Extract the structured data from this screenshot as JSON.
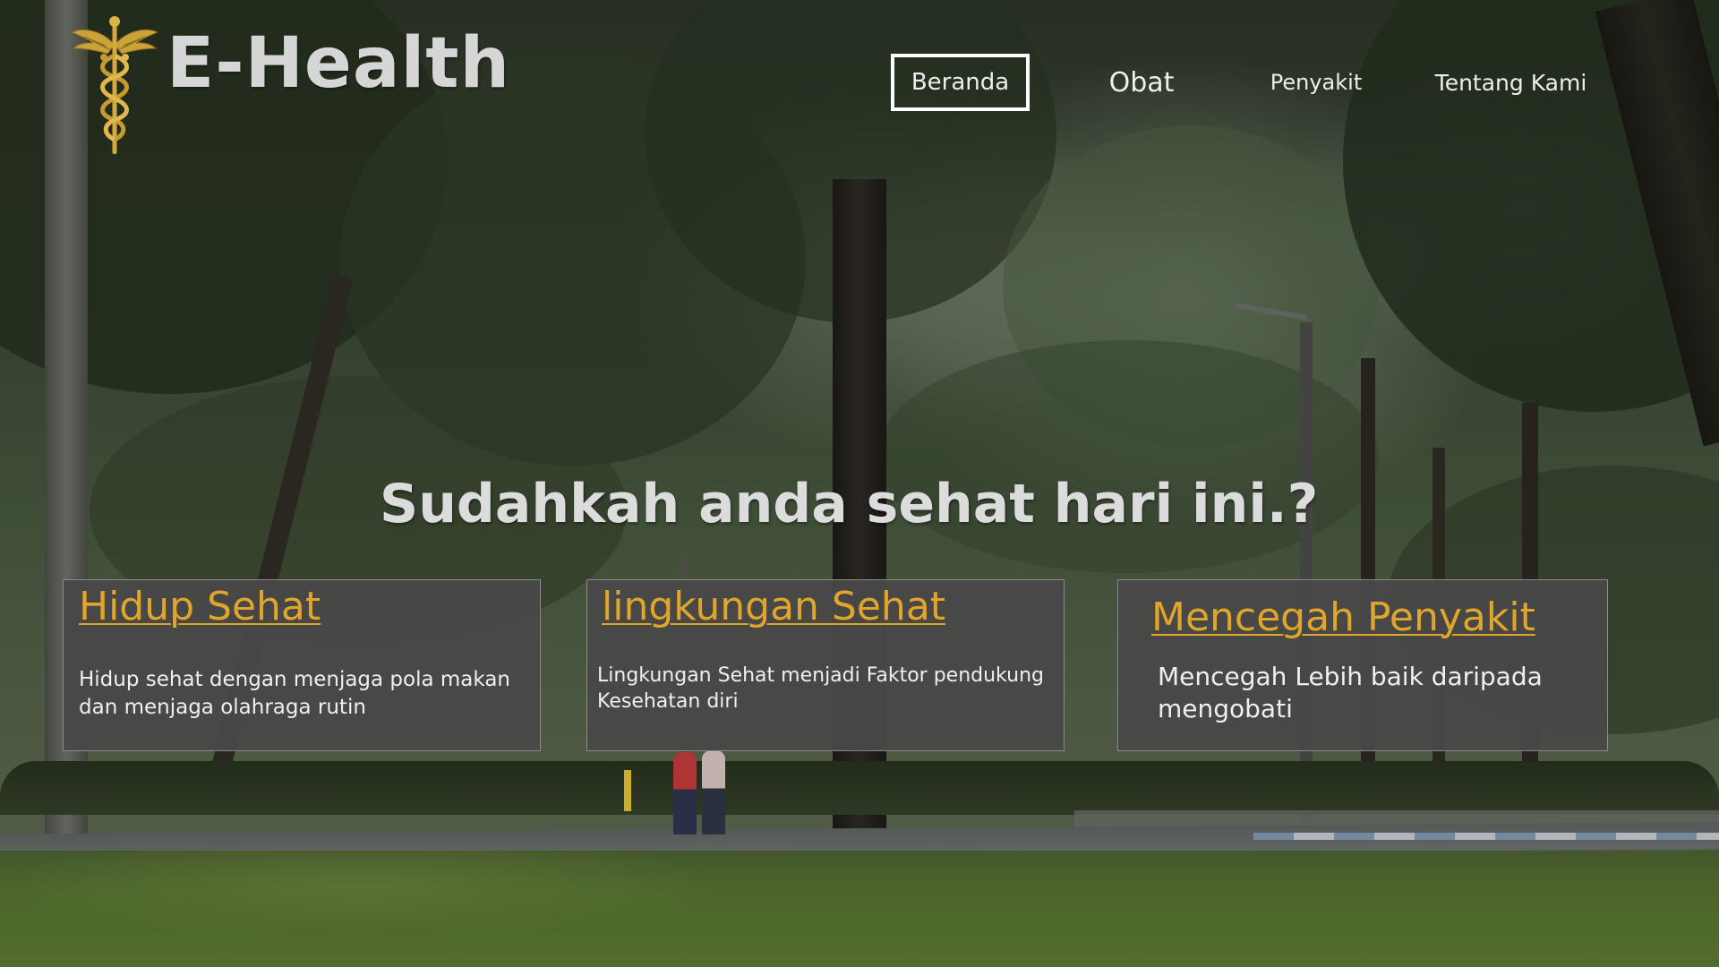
{
  "header": {
    "logo_text": "E-Health",
    "logo_icon": "caduceus-icon",
    "nav": [
      {
        "label": "Beranda",
        "active": true
      },
      {
        "label": "Obat",
        "active": false
      },
      {
        "label": "Penyakit",
        "active": false
      },
      {
        "label": "Tentang Kami",
        "active": false
      }
    ]
  },
  "hero": {
    "headline": "Sudahkah anda sehat hari ini.?"
  },
  "cards": [
    {
      "title": "Hidup Sehat",
      "description": "Hidup sehat dengan menjaga pola makan dan menjaga olahraga rutin"
    },
    {
      "title": "lingkungan Sehat",
      "description": "Lingkungan Sehat menjadi Faktor pendukung Kesehatan diri"
    },
    {
      "title": "Mencegah Penyakit",
      "description": "Mencegah Lebih baik daripada mengobati"
    }
  ],
  "colors": {
    "accent_gold": "#e0a52b",
    "card_background": "#484848",
    "text_light": "#efefef",
    "background": "#3a4634"
  }
}
